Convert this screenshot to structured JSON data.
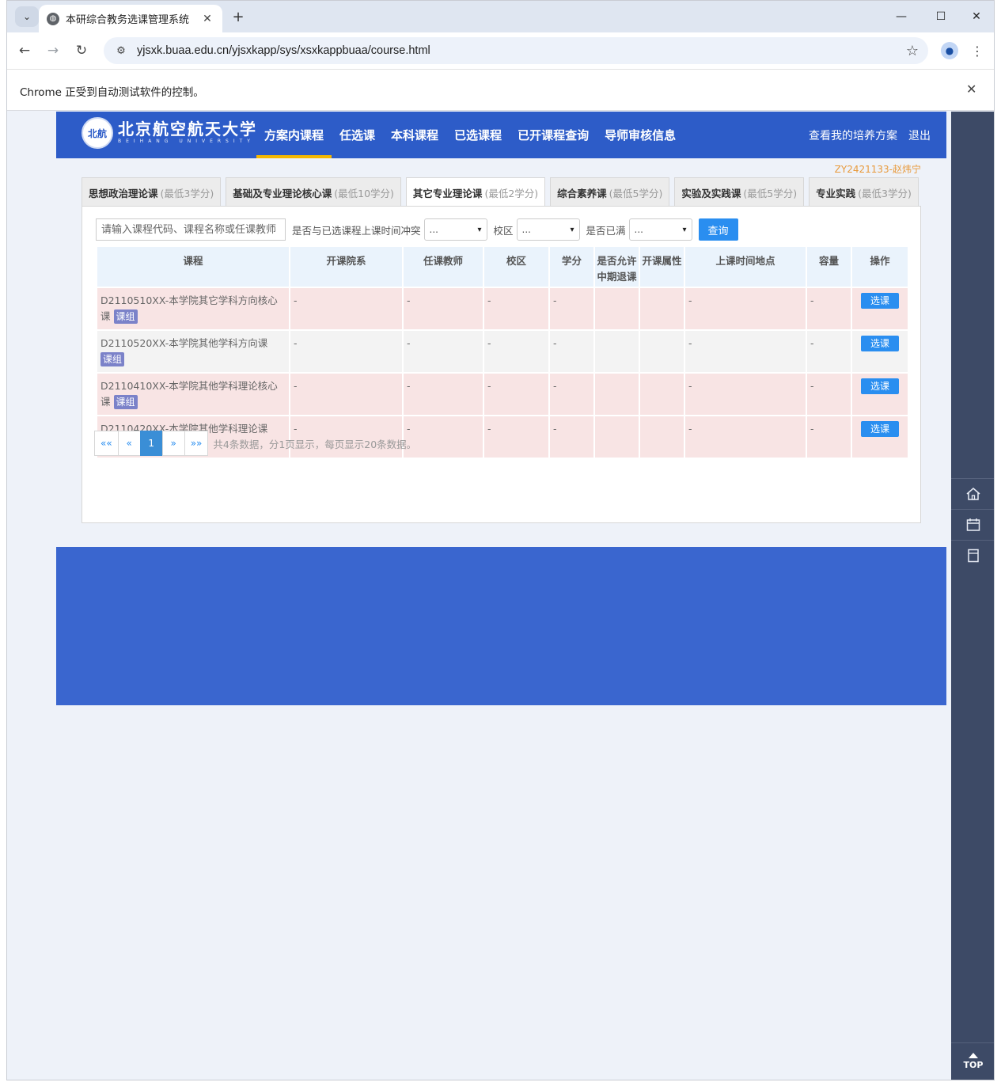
{
  "browser": {
    "tab_title": "本研综合教务选课管理系统",
    "url": "yjsxk.buaa.edu.cn/yjsxkapp/sys/xsxkappbuaa/course.html",
    "infobar_text": "Chrome 正受到自动测试软件的控制。",
    "dropdown_glyph": "⌄",
    "close_glyph": "✕",
    "new_tab_glyph": "+",
    "minimize_glyph": "—",
    "maximize_glyph": "☐",
    "back_glyph": "←",
    "forward_glyph": "→",
    "reload_glyph": "↻",
    "star_glyph": "☆",
    "menu_glyph": "⋮"
  },
  "site": {
    "logo_seal": "北航",
    "logo_cn": "北京航空航天大学",
    "logo_en": "BEIHANG UNIVERSITY",
    "nav": [
      {
        "label": "方案内课程",
        "active": true
      },
      {
        "label": "任选课",
        "active": false
      },
      {
        "label": "本科课程",
        "active": false
      },
      {
        "label": "已选课程",
        "active": false
      },
      {
        "label": "已开课程查询",
        "active": false
      },
      {
        "label": "导师审核信息",
        "active": false
      }
    ],
    "right_nav": {
      "plan": "查看我的培养方案",
      "logout": "退出"
    },
    "user": "ZY2421133-赵炜宁"
  },
  "category_tabs": [
    {
      "name": "思想政治理论课",
      "min": "(最低3学分)",
      "active": false
    },
    {
      "name": "基础及专业理论核心课",
      "min": "(最低10学分)",
      "active": false
    },
    {
      "name": "其它专业理论课",
      "min": "(最低2学分)",
      "active": true
    },
    {
      "name": "综合素养课",
      "min": "(最低5学分)",
      "active": false
    },
    {
      "name": "实验及实践课",
      "min": "(最低5学分)",
      "active": false
    },
    {
      "name": "专业实践",
      "min": "(最低3学分)",
      "active": false
    }
  ],
  "filters": {
    "search_placeholder": "请输入课程代码、课程名称或任课教师",
    "conflict_label": "是否与已选课程上课时间冲突",
    "conflict_value": "...",
    "campus_label": "校区",
    "campus_value": "...",
    "full_label": "是否已满",
    "full_value": "...",
    "query_label": "查询"
  },
  "table": {
    "headers": {
      "course": "课程",
      "dept": "开课院系",
      "teacher": "任课教师",
      "campus": "校区",
      "credit": "学分",
      "withdraw_1": "是否允许",
      "withdraw_2": "中期退课",
      "attr": "开课属性",
      "time": "上课时间地点",
      "capacity": "容量",
      "op": "操作"
    },
    "group_badge": "课组",
    "select_label": "选课",
    "rows": [
      {
        "course": "D2110510XX-本学院其它学科方向核心课",
        "dept": "-",
        "teacher": "-",
        "campus": "-",
        "credit": "-",
        "withdraw": "",
        "attr": "",
        "time": "-",
        "capacity": "-"
      },
      {
        "course": "D2110520XX-本学院其他学科方向课",
        "dept": "-",
        "teacher": "-",
        "campus": "-",
        "credit": "-",
        "withdraw": "",
        "attr": "",
        "time": "-",
        "capacity": "-"
      },
      {
        "course": "D2110410XX-本学院其他学科理论核心课",
        "dept": "-",
        "teacher": "-",
        "campus": "-",
        "credit": "-",
        "withdraw": "",
        "attr": "",
        "time": "-",
        "capacity": "-"
      },
      {
        "course": "D2110420XX-本学院其他学科理论课",
        "dept": "-",
        "teacher": "-",
        "campus": "-",
        "credit": "-",
        "withdraw": "",
        "attr": "",
        "time": "-",
        "capacity": "-"
      }
    ]
  },
  "pager": {
    "first": "««",
    "prev": "«",
    "current": "1",
    "next": "»",
    "last": "»»",
    "summary": "共4条数据，分1页显示，每页显示20条数据。"
  },
  "sidebar": {
    "icons": [
      "home-icon",
      "calendar-icon",
      "document-icon"
    ],
    "top_label": "TOP"
  }
}
